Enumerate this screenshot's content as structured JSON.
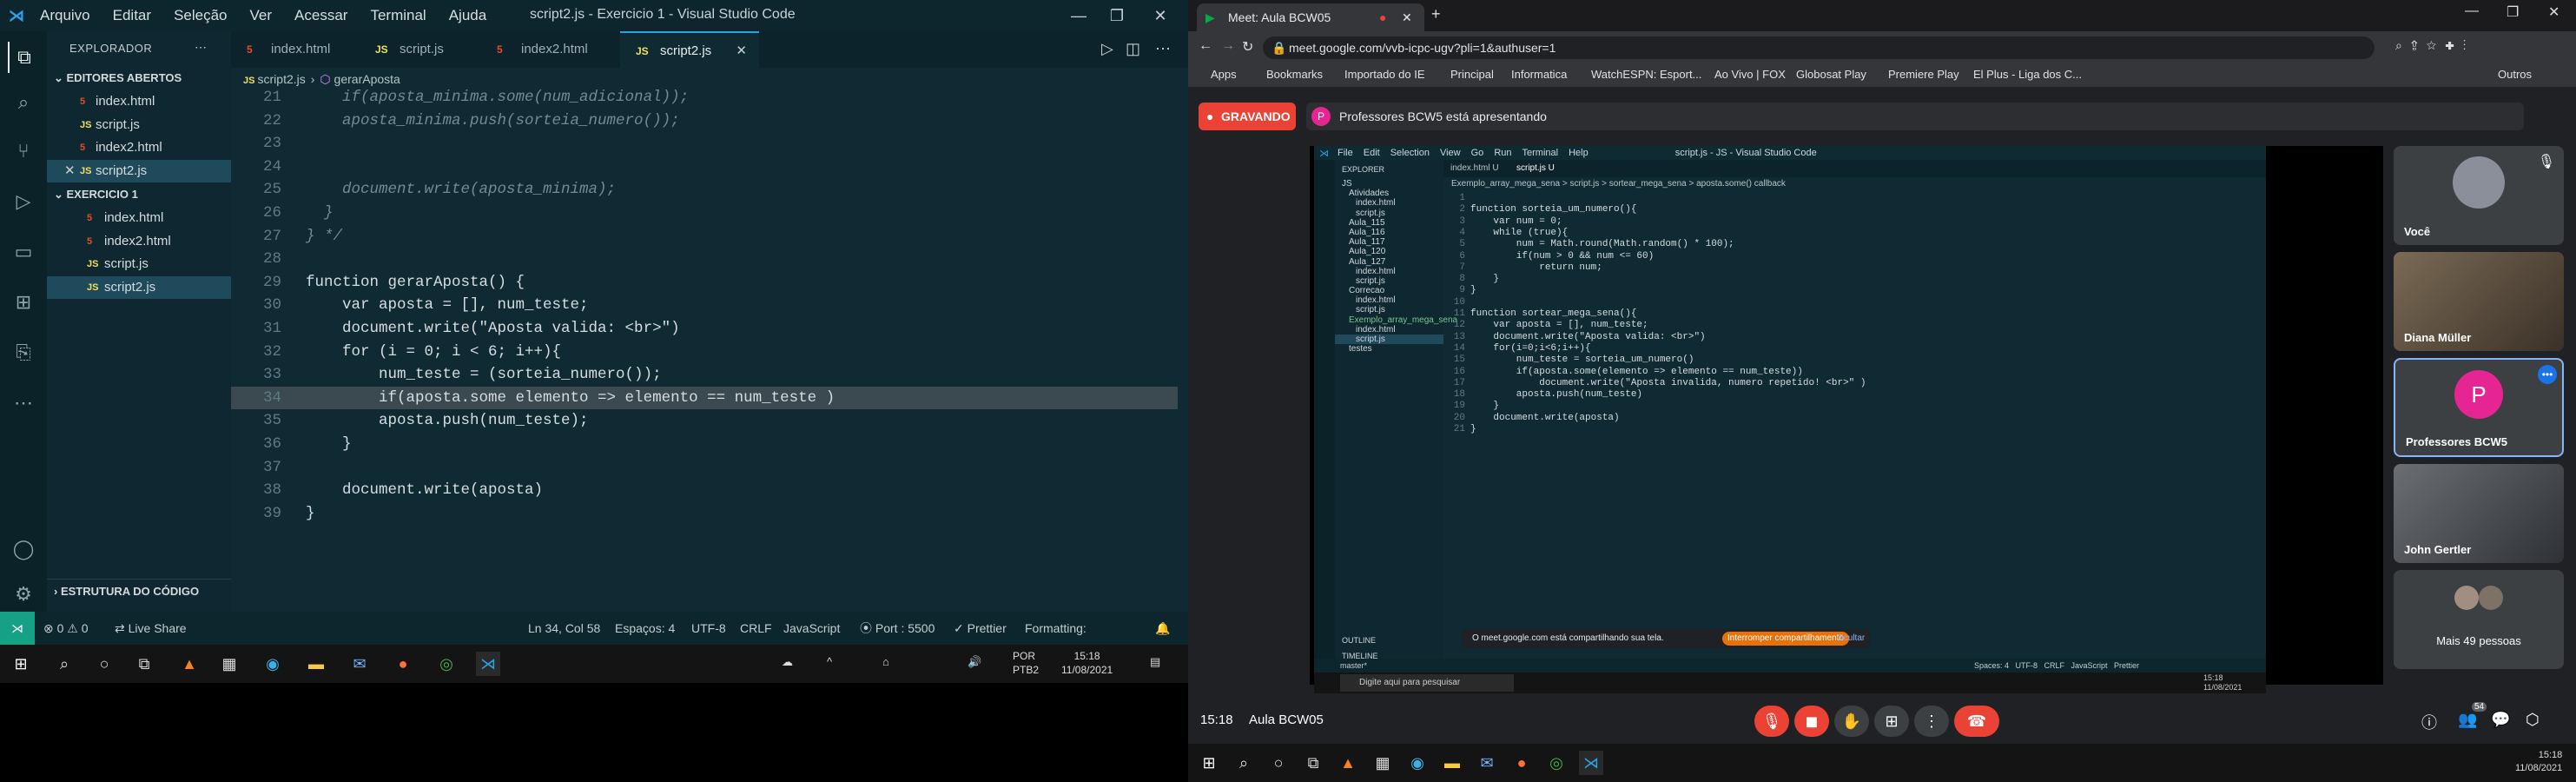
{
  "vscode": {
    "menu": [
      "Arquivo",
      "Editar",
      "Seleção",
      "Ver",
      "Acessar",
      "Terminal",
      "Ajuda"
    ],
    "title": "script2.js - Exercicio 1 - Visual Studio Code",
    "sidebar": {
      "header": "EXPLORADOR",
      "open_editors_title": "EDITORES ABERTOS",
      "open_editors": [
        {
          "name": "index.html",
          "type": "html"
        },
        {
          "name": "script.js",
          "type": "js"
        },
        {
          "name": "index2.html",
          "type": "html"
        },
        {
          "name": "script2.js",
          "type": "js"
        }
      ],
      "folder_title": "EXERCICIO 1",
      "files": [
        {
          "name": "index.html",
          "type": "html"
        },
        {
          "name": "index2.html",
          "type": "html"
        },
        {
          "name": "script.js",
          "type": "js"
        },
        {
          "name": "script2.js",
          "type": "js"
        }
      ],
      "outline_title": "ESTRUTURA DO CÓDIGO"
    },
    "tabs": [
      {
        "label": "index.html",
        "type": "html"
      },
      {
        "label": "script.js",
        "type": "js"
      },
      {
        "label": "index2.html",
        "type": "html"
      },
      {
        "label": "script2.js",
        "type": "js"
      }
    ],
    "breadcrumb": {
      "file": "script2.js",
      "symbol": "gerarAposta"
    },
    "code": [
      {
        "n": "21",
        "t": "    if(aposta_minima.some(num_adicional));"
      },
      {
        "n": "22",
        "t": "    aposta_minima.push(sorteia_numero());"
      },
      {
        "n": "23",
        "t": ""
      },
      {
        "n": "24",
        "t": ""
      },
      {
        "n": "25",
        "t": "    document.write(aposta_minima);"
      },
      {
        "n": "26",
        "t": "  }"
      },
      {
        "n": "27",
        "t": "} */"
      },
      {
        "n": "28",
        "t": ""
      },
      {
        "n": "29",
        "t": "function gerarAposta() {"
      },
      {
        "n": "30",
        "t": "    var aposta = [], num_teste;"
      },
      {
        "n": "31",
        "t": "    document.write(\"Aposta valida: <br>\")"
      },
      {
        "n": "32",
        "t": "    for (i = 0; i < 6; i++){"
      },
      {
        "n": "33",
        "t": "        num_teste = (sorteia_numero());"
      },
      {
        "n": "34",
        "t": "        if(aposta.some elemento => elemento == num_teste )"
      },
      {
        "n": "35",
        "t": "        aposta.push(num_teste);"
      },
      {
        "n": "36",
        "t": "    }"
      },
      {
        "n": "37",
        "t": ""
      },
      {
        "n": "38",
        "t": "    document.write(aposta)"
      },
      {
        "n": "39",
        "t": "}"
      }
    ],
    "status": {
      "errors": "0",
      "warnings": "0",
      "live_share": "Live Share",
      "position": "Ln 34, Col 58",
      "spaces": "Espaços: 4",
      "encoding": "UTF-8",
      "eol": "CRLF",
      "language": "JavaScript",
      "port": "Port : 5500",
      "prettier": "Prettier",
      "formatting": "Formatting:"
    }
  },
  "left_taskbar": {
    "lang": "POR",
    "layout": "PTB2",
    "time": "15:18",
    "date": "11/08/2021"
  },
  "chrome": {
    "tab_title": "Meet: Aula BCW05",
    "url": "meet.google.com/vvb-icpc-ugv?pli=1&authuser=1",
    "bookmarks": [
      "Apps",
      "Bookmarks",
      "Importado do IE",
      "Principal",
      "Informatica",
      "WatchESPN: Esport...",
      "Ao Vivo | FOX",
      "Globosat Play",
      "Premiere Play",
      "El Plus - Liga dos C...",
      "Outros favoritos"
    ]
  },
  "meet": {
    "recording": "GRAVANDO",
    "presenting": "Professores BCW5 está apresentando",
    "presenter_initial": "P",
    "meeting_time": "15:18",
    "meeting_name": "Aula BCW05",
    "tiles": [
      {
        "name": "Você"
      },
      {
        "name": "Diana Müller"
      },
      {
        "name": "Professores BCW5",
        "initial": "P"
      },
      {
        "name": "John Gertler"
      },
      {
        "name": "Mais 49 pessoas"
      }
    ],
    "people_count": "54",
    "share_notice": "O meet.google.com está compartilhando sua tela.",
    "stop_share": "Interromper compartilhamento",
    "hide": "Ocultar",
    "inner_vscode": {
      "menu": [
        "File",
        "Edit",
        "Selection",
        "View",
        "Go",
        "Run",
        "Terminal",
        "Help"
      ],
      "title": "script.js - JS - Visual Studio Code",
      "tabs": [
        "index.html U",
        "script.js U"
      ],
      "explorer": "EXPLORER",
      "breadcrumb": "Exemplo_array_mega_sena > script.js > sortear_mega_sena > aposta.some() callback",
      "tree": [
        "JS",
        "Atividades",
        "index.html",
        "script.js",
        "Aula_115",
        "Aula_116",
        "Aula_117",
        "Aula_120",
        "Aula_127",
        "index.html",
        "script.js",
        "Correcao",
        "index.html",
        "script.js",
        "Exemplo_array_mega_sena",
        "index.html",
        "script.js",
        "testes"
      ],
      "outline": "OUTLINE",
      "timeline": "TIMELINE",
      "code": [
        {
          "n": "1",
          "t": ""
        },
        {
          "n": "2",
          "t": "function sorteia_um_numero(){"
        },
        {
          "n": "3",
          "t": "    var num = 0;"
        },
        {
          "n": "4",
          "t": "    while (true){"
        },
        {
          "n": "5",
          "t": "        num = Math.round(Math.random() * 100);"
        },
        {
          "n": "6",
          "t": "        if(num > 0 && num <= 60)"
        },
        {
          "n": "7",
          "t": "            return num;"
        },
        {
          "n": "8",
          "t": "    }"
        },
        {
          "n": "9",
          "t": "}"
        },
        {
          "n": "10",
          "t": ""
        },
        {
          "n": "11",
          "t": "function sortear_mega_sena(){"
        },
        {
          "n": "12",
          "t": "    var aposta = [], num_teste;"
        },
        {
          "n": "13",
          "t": "    document.write(\"Aposta valida: <br>\")"
        },
        {
          "n": "14",
          "t": "    for(i=0;i<6;i++){"
        },
        {
          "n": "15",
          "t": "        num_teste = sorteia_um_numero()"
        },
        {
          "n": "16",
          "t": "        if(aposta.some(elemento => elemento == num_teste))"
        },
        {
          "n": "17",
          "t": "            document.write(\"Aposta invalida, numero repetido! <br>\" )"
        },
        {
          "n": "18",
          "t": "        aposta.push(num_teste)"
        },
        {
          "n": "19",
          "t": "    }"
        },
        {
          "n": "20",
          "t": "    document.write(aposta)"
        },
        {
          "n": "21",
          "t": "}"
        }
      ],
      "status_left": "master*",
      "status_right": "Spaces: 4   UTF-8   CRLF   JavaScript   Prettier",
      "search": "Digite aqui para pesquisar",
      "clock": "15:18",
      "date": "11/08/2021"
    }
  },
  "right_taskbar": {
    "time": "15:18",
    "date": "11/08/2021"
  }
}
